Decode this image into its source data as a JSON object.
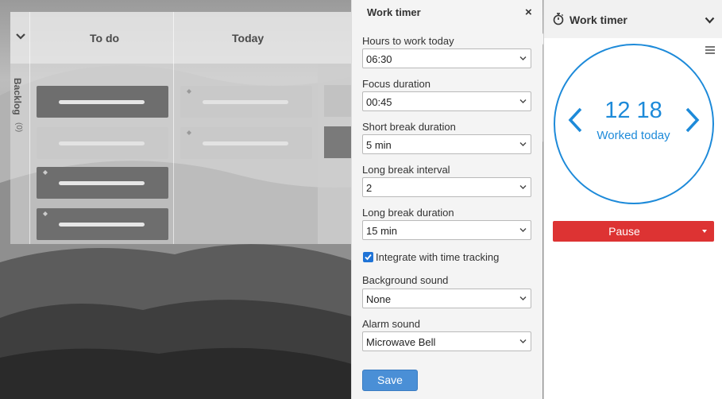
{
  "board": {
    "columns": [
      "To do",
      "Today"
    ],
    "backlog_label": "Backlog",
    "backlog_count": "(0)"
  },
  "settings": {
    "title": "Work timer",
    "fields": [
      {
        "label": "Hours to work today",
        "value": "06:30"
      },
      {
        "label": "Focus duration",
        "value": "00:45"
      },
      {
        "label": "Short break duration",
        "value": "5 min"
      },
      {
        "label": "Long break interval",
        "value": "2"
      },
      {
        "label": "Long break duration",
        "value": "15 min"
      }
    ],
    "integrate_label": "Integrate with time tracking",
    "integrate_checked": true,
    "background_sound": {
      "label": "Background sound",
      "value": "None"
    },
    "alarm_sound": {
      "label": "Alarm sound",
      "value": "Microwave Bell"
    },
    "save_label": "Save"
  },
  "timer": {
    "title": "Work timer",
    "time": "12 18",
    "caption": "Worked today",
    "pause_label": "Pause",
    "accent_color": "#1d8ad9",
    "pause_color": "#dd3333"
  },
  "icons": [
    "stopwatch-icon",
    "chevron-down-icon",
    "menu-icon",
    "close-icon",
    "chevron-left-icon",
    "chevron-right-icon",
    "checkbox-checked-icon"
  ]
}
